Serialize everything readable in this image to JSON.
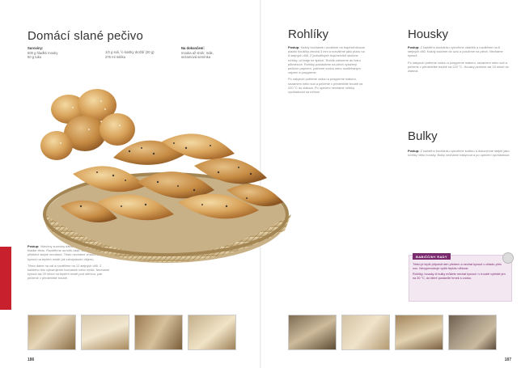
{
  "left_page": {
    "title": "Domácí slané pečivo",
    "ingredients": {
      "col1_label": "Suroviny:",
      "col1_lines": [
        "500 g hladké mouky",
        "50 g tuku"
      ],
      "col2_lines": [
        "1/2 g soli, ½ kostky droždí (20 g)",
        "275 ml mléka"
      ],
      "col3_label": "Na dokončení:",
      "col3_lines": [
        "mouka až směr, mák,",
        "sezamová semínka"
      ]
    },
    "postup": {
      "label": "Postup:",
      "p1": "Všechny suroviny dáme do misy a vypracujeme hladké těsto. Rozdělíme na tolik částí, které budou mít přibližně stejné množství. Těsto necháme zhruba 30 min kynout na teplém místě (až zdvojnásobí objem).",
      "p2": "Těsto dáme na vál a rozdělíme na 12 stejných dílů. Z každého dílu vytvarujeme bochánek nebo rohlík. Necháme kynout asi 20 minut na teplém místě pod utěrkou, pak pečeme v předehřáté troubě."
    },
    "page_number": "186"
  },
  "right_page": {
    "rohliky": {
      "title": "Rohlíky",
      "label": "Postup:",
      "p1": "Každý bochánek rozválíme na trojúhelníkovou placku tloušťky zhruba 3 mm a rozválíme jako pizzu na 8 stejných dílů. Z jednotlivých trojúhelníků stočíme rohlíky, od kraje ke špičce. Rohlík zahneme do tvaru půlměsíce. Rohlíky pokládáme na plech vyložený pečicím papírem, potřeme vodou nebo rozšlehaným vejcem a posypeme.",
      "p2": "Po nakynutí potřeme vodou a posypeme makem, sezamem nebo solí a pečeme v předehřáté troubě na 220 °C do zlatova. Po upečení necháme rohlíky vychladnout na mřížce."
    },
    "housky": {
      "title": "Housky",
      "label": "Postup:",
      "p1": "Z každého bochánku vytvoříme váleček a rozdělíme na 8 stejných dílů. Každý stočíme do uzlu a položíme na plech. Necháme kynout.",
      "p2": "Po nakynutí potřeme vodou a posypeme makem, sezamem nebo solí a pečeme v předehřáté troubě na 220 °C. Housky pečeme asi 15 minut do zlatova."
    },
    "bulky": {
      "title": "Bulky",
      "label": "Postup:",
      "p1": "Z každého bochánku vytvoříme kuličku a dokončíme stejně jako rohlíky nebo housky. Bulky necháme nakynout a po upečení vychladnout."
    },
    "tip": {
      "head": "BABIČČINY RADY",
      "p1": "Těsto je lepší připravit den předem a nechat kynout v chladu přes noc. Nevyprovokuje vyšší teplotu vlhkost.",
      "p2": "Rohlíky, housky či bulky můžete nechat kynout i v troubě vyhřáté jen na 30 °C, do které postavíte hrnek s vodou."
    },
    "page_number": "187"
  },
  "colors": {
    "accent_red": "#c8202c",
    "tip_purple": "#7b2a6e",
    "tip_bg": "#f3e7f2"
  }
}
